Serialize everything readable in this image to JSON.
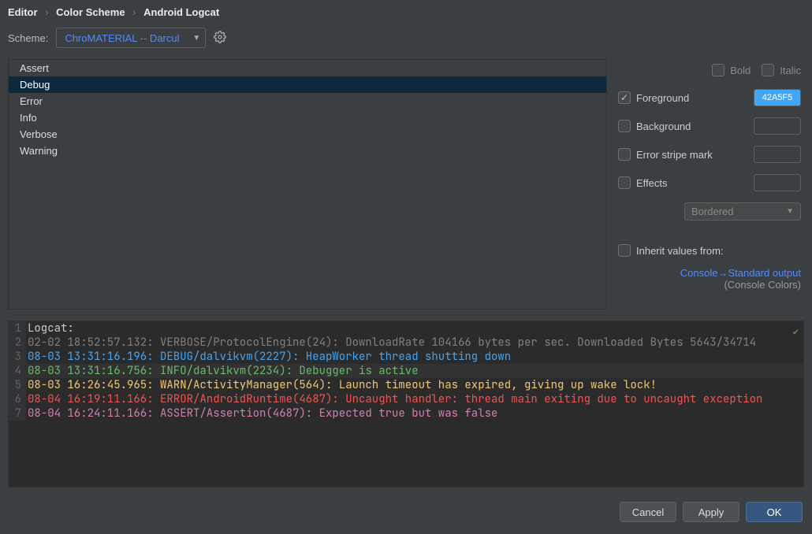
{
  "breadcrumb": {
    "a": "Editor",
    "b": "Color Scheme",
    "c": "Android Logcat"
  },
  "scheme": {
    "label": "Scheme:",
    "value": "ChroMATERIAL -- Darcul"
  },
  "categories": {
    "items": [
      "Assert",
      "Debug",
      "Error",
      "Info",
      "Verbose",
      "Warning"
    ],
    "selected_index": 1
  },
  "font_style": {
    "bold": "Bold",
    "italic": "Italic"
  },
  "props": {
    "foreground": {
      "label": "Foreground",
      "checked": true,
      "value": "42A5F5",
      "swatch": "#42A5F5"
    },
    "background": {
      "label": "Background",
      "checked": false
    },
    "error_stripe": {
      "label": "Error stripe mark",
      "checked": false
    },
    "effects": {
      "label": "Effects",
      "checked": false,
      "type": "Bordered"
    }
  },
  "inherit": {
    "label": "Inherit values from:",
    "link": "Console→Standard output",
    "sub": "(Console Colors)"
  },
  "preview": {
    "title": "Logcat:",
    "lines": [
      {
        "n": "2",
        "cls": "c-gray",
        "text": "02-02 18:52:57.132: VERBOSE/ProtocolEngine(24): DownloadRate 104166 bytes per sec. Downloaded Bytes 5643/34714"
      },
      {
        "n": "3",
        "cls": "c-blue",
        "text": "08-03 13:31:16.196: DEBUG/dalvikvm(2227): HeapWorker thread shutting down"
      },
      {
        "n": "4",
        "cls": "c-green",
        "hl": true,
        "text": "08-03 13:31:16.756: INFO/dalvikvm(2234): Debugger is active"
      },
      {
        "n": "5",
        "cls": "c-yellow",
        "text": "08-03 16:26:45.965: WARN/ActivityManager(564): Launch timeout has expired, giving up wake lock!"
      },
      {
        "n": "6",
        "cls": "c-red",
        "text": "08-04 16:19:11.166: ERROR/AndroidRuntime(4687): Uncaught handler: thread main exiting due to uncaught exception"
      },
      {
        "n": "7",
        "cls": "c-pink",
        "text": "08-04 16:24:11.166: ASSERT/Assertion(4687): Expected true but was false"
      }
    ]
  },
  "buttons": {
    "cancel": "Cancel",
    "apply": "Apply",
    "ok": "OK"
  }
}
